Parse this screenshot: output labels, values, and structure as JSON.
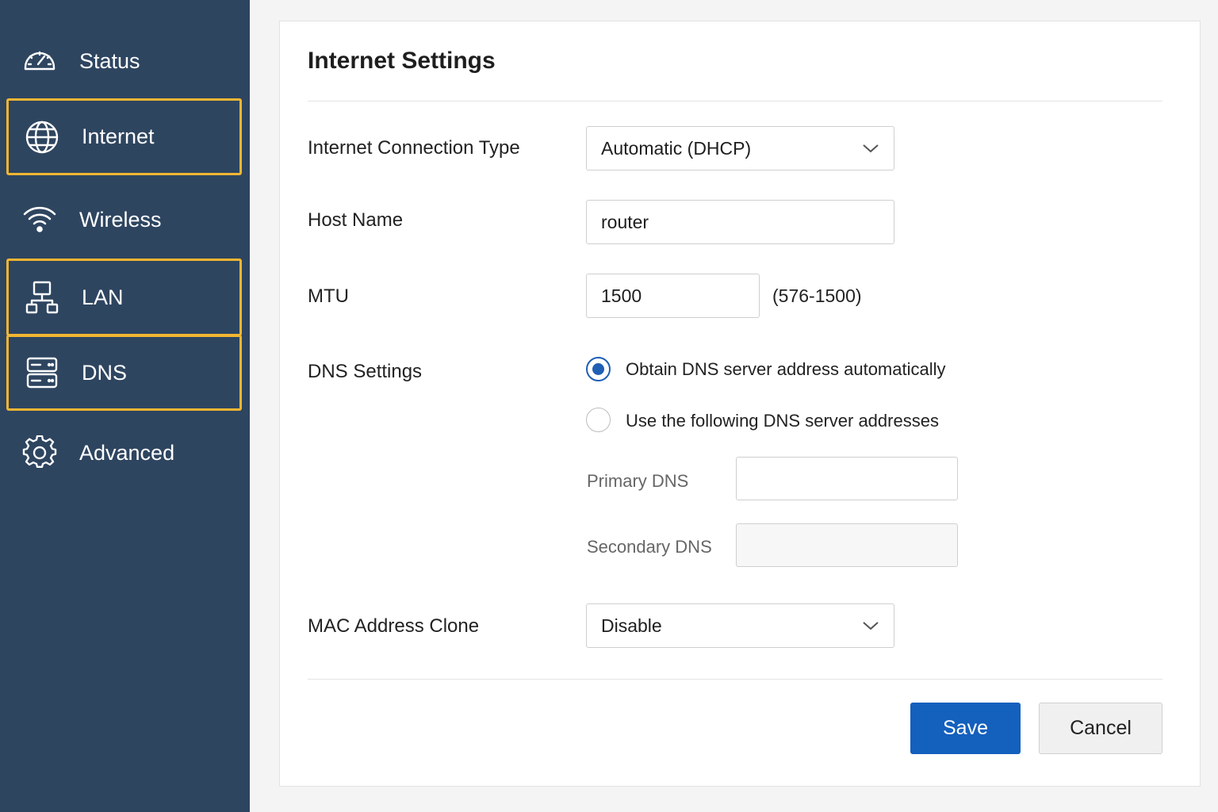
{
  "sidebar": {
    "items": [
      {
        "label": "Status",
        "icon": "gauge-icon",
        "highlighted": false
      },
      {
        "label": "Internet",
        "icon": "globe-icon",
        "highlighted": true
      },
      {
        "label": "Wireless",
        "icon": "wifi-icon",
        "highlighted": false
      },
      {
        "label": "LAN",
        "icon": "network-icon",
        "highlighted": true
      },
      {
        "label": "DNS",
        "icon": "server-icon",
        "highlighted": true
      },
      {
        "label": "Advanced",
        "icon": "gear-icon",
        "highlighted": false
      }
    ],
    "background": "#2e4560",
    "highlight_color": "#f2b632"
  },
  "main": {
    "title": "Internet Settings",
    "connection_type": {
      "label": "Internet Connection Type",
      "value": "Automatic (DHCP)"
    },
    "host_name": {
      "label": "Host Name",
      "value": "router"
    },
    "mtu": {
      "label": "MTU",
      "value": "1500",
      "hint": "(576-1500)"
    },
    "dns": {
      "label": "DNS Settings",
      "options": [
        {
          "label": "Obtain DNS server address automatically",
          "selected": true
        },
        {
          "label": "Use the following DNS server addresses",
          "selected": false
        }
      ],
      "primary_label": "Primary DNS",
      "primary_value": "",
      "secondary_label": "Secondary DNS",
      "secondary_value": ""
    },
    "mac_clone": {
      "label": "MAC Address Clone",
      "value": "Disable"
    },
    "buttons": {
      "save": "Save",
      "cancel": "Cancel"
    },
    "accent_color": "#1460bd"
  }
}
